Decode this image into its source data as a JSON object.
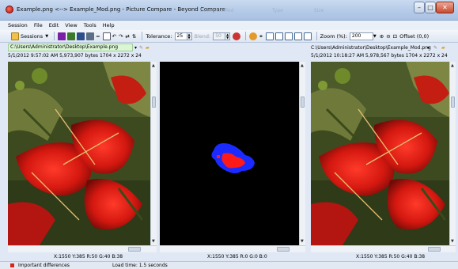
{
  "window": {
    "title": "Example.png <--> Example_Mod.png - Picture Compare - Beyond Compare",
    "ghost_headers": [
      "Date modified",
      "Type",
      "Size"
    ],
    "buttons": {
      "minimize": "–",
      "maximize": "□",
      "close": "✕"
    }
  },
  "menu": [
    "Session",
    "File",
    "Edit",
    "View",
    "Tools",
    "Help"
  ],
  "toolbar": {
    "sessions_label": "Sessions",
    "tolerance_label": "Tolerance:",
    "tolerance_value": "25",
    "blend_label": "Blend:",
    "blend_value": "50",
    "zoom_label": "Zoom (%):",
    "zoom_value": "200",
    "offset_label": "Offset (0,0)"
  },
  "left": {
    "path": "C:\\Users\\Administrator\\Desktop\\Example.png",
    "info": "5/1/2012 9:57:02 AM   5,973,907 bytes   1704 x 2272 x 24",
    "pixel": "X:1550 Y:385 R:50 G:40 B:38"
  },
  "center": {
    "pixel": "X:1550 Y:385 R:0 G:0 B:0"
  },
  "right": {
    "path": "C:\\Users\\Administrator\\Desktop\\Example_Mod.png",
    "info": "5/1/2012 10:18:27 AM   5,978,567 bytes   1704 x 2272 x 24",
    "pixel": "X:1550 Y:385 R:50 G:40 B:38"
  },
  "status": {
    "important": "Important differences",
    "load_time": "Load time: 1.5 seconds"
  },
  "colors": {
    "accent": "#c9daf0",
    "diff_blue": "#1b2bff",
    "diff_red": "#ff1a1a",
    "path_bg": "#dcf5d6"
  }
}
